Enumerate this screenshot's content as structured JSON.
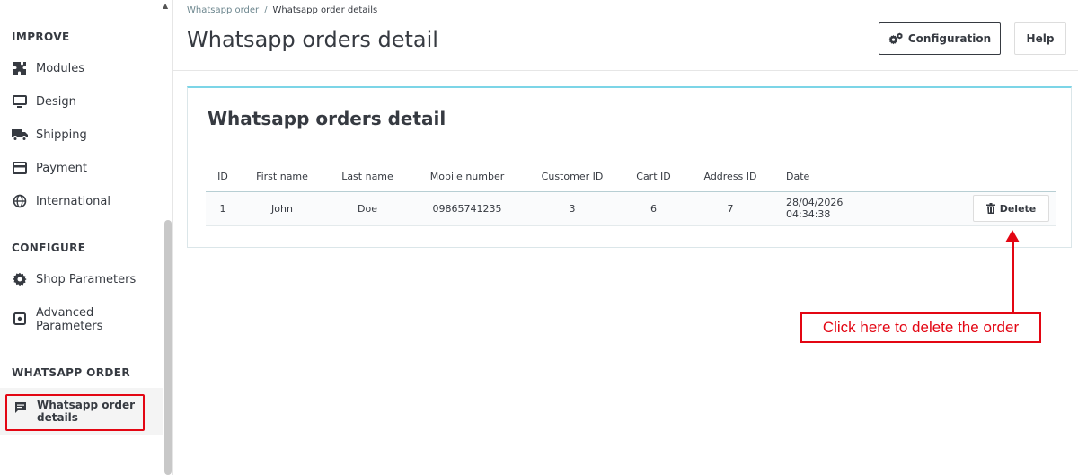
{
  "sidebar": {
    "sections": [
      {
        "title": "IMPROVE",
        "items": [
          {
            "label": "Modules",
            "icon": "puzzle-icon"
          },
          {
            "label": "Design",
            "icon": "monitor-icon"
          },
          {
            "label": "Shipping",
            "icon": "truck-icon"
          },
          {
            "label": "Payment",
            "icon": "credit-card-icon"
          },
          {
            "label": "International",
            "icon": "globe-icon"
          }
        ]
      },
      {
        "title": "CONFIGURE",
        "items": [
          {
            "label": "Shop Parameters",
            "icon": "gear-icon"
          },
          {
            "label": "Advanced Parameters",
            "label_line1": "Advanced",
            "label_line2": "Parameters",
            "icon": "settings-box-icon"
          }
        ]
      },
      {
        "title": "WHATSAPP ORDER",
        "items": [
          {
            "label": "Whatsapp order details",
            "label_line1": "Whatsapp order",
            "label_line2": "details",
            "icon": "message-icon",
            "active": true
          }
        ]
      }
    ]
  },
  "header": {
    "breadcrumb": [
      "Whatsapp order",
      "Whatsapp order details"
    ],
    "title": "Whatsapp orders detail",
    "config_label": "Configuration",
    "help_label": "Help"
  },
  "card": {
    "title": "Whatsapp orders detail",
    "columns": [
      "ID",
      "First name",
      "Last name",
      "Mobile number",
      "Customer ID",
      "Cart ID",
      "Address ID",
      "Date",
      ""
    ],
    "rows": [
      {
        "id": "1",
        "first_name": "John",
        "last_name": "Doe",
        "mobile": "09865741235",
        "customer_id": "3",
        "cart_id": "6",
        "address_id": "7",
        "date": "28/04/2026 04:34:38",
        "delete_label": "Delete"
      }
    ]
  },
  "annotation": {
    "text": "Click here to delete the order",
    "color": "#e30613"
  },
  "colors": {
    "accent_border": "#7cd5e7",
    "text": "#363a41",
    "breadcrumb": "#6c868e"
  }
}
